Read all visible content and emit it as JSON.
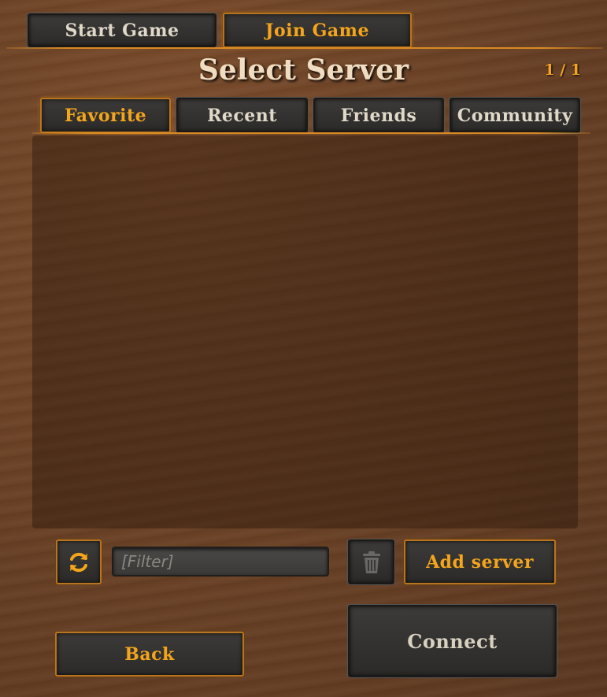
{
  "top_tabs": [
    {
      "label": "Start Game",
      "active": false
    },
    {
      "label": "Join Game",
      "active": true
    }
  ],
  "title": "Select Server",
  "page_counter": "1 / 1",
  "server_tabs": [
    {
      "label": "Favorite",
      "active": true
    },
    {
      "label": "Recent",
      "active": false
    },
    {
      "label": "Friends",
      "active": false
    },
    {
      "label": "Community",
      "active": false
    }
  ],
  "filter": {
    "placeholder": "[Filter]",
    "value": ""
  },
  "icons": {
    "refresh": "refresh-icon",
    "delete": "trash-icon"
  },
  "buttons": {
    "add_server": "Add server",
    "connect": "Connect",
    "back": "Back"
  },
  "colors": {
    "accent": "#f4a51c",
    "text": "#e0d8c8",
    "wood": "#6b4226"
  }
}
